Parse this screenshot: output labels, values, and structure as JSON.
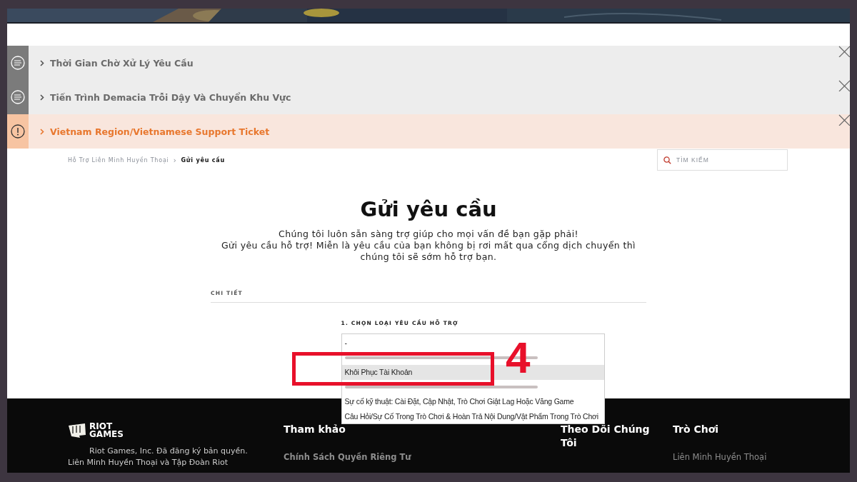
{
  "banner": {
    "kind": "picture"
  },
  "notices": [
    {
      "kind": "info",
      "title": "Thời Gian Chờ Xử Lý Yêu Cầu"
    },
    {
      "kind": "info",
      "title": "Tiến Trình Demacia Trỗi Dậy Và Chuyển Khu Vực"
    },
    {
      "kind": "warning",
      "title": "Vietnam Region/Vietnamese Support Ticket"
    }
  ],
  "breadcrumb": [
    {
      "label": "Hỗ Trợ Liên Minh Huyền Thoại",
      "selected": false
    },
    {
      "label": "Gửi yêu cầu",
      "selected": true
    }
  ],
  "breadcrumb_separator": "›",
  "search": {
    "placeholder": "TÌM KIẾM"
  },
  "title": "Gửi yêu cầu",
  "intro": [
    "Chúng tôi luôn sẵn sàng trợ giúp cho mọi vấn đề bạn gặp phải!",
    "Gửi yêu cầu hỗ trợ! Miễn là yêu cầu của bạn không bị rơi mất qua cổng dịch chuyển thì chúng tôi sẽ sớm hỗ trợ bạn."
  ],
  "section_label": "CHI TIẾT",
  "field_label": "1. CHỌN LOẠI YÊU CẦU HỖ TRỢ",
  "options": [
    {
      "kind": "text",
      "label": "-",
      "selected": false
    },
    {
      "kind": "obscured",
      "selected": false
    },
    {
      "kind": "text",
      "label": "Khôi Phục Tài Khoản",
      "selected": true
    },
    {
      "kind": "obscured",
      "selected": false
    },
    {
      "kind": "text",
      "label": "Sự cố kỹ thuật: Cài Đặt, Cập Nhật, Trò Chơi Giật Lag Hoặc Văng Game",
      "selected": false
    },
    {
      "kind": "text",
      "label": "Câu Hỏi/Sự Cố Trong Trò Chơi & Hoàn Trả Nội Dung/Vật Phẩm Trong Trò Chơi",
      "selected": false
    }
  ],
  "annotation": {
    "label": "4"
  },
  "footer": {
    "logo": [
      "RIOT",
      "GAMES"
    ],
    "copyright": "Riot Games, Inc. Đã đăng ký bản quyền. Liên Minh Huyền Thoại và Tập Đoàn Riot",
    "columns": [
      {
        "heading": "Tham khảo",
        "links": [
          "Chính Sách Quyền Riêng Tư"
        ]
      },
      {
        "heading": "Theo Dõi Chúng Tôi"
      },
      {
        "heading": "Trò Chơi",
        "links": [
          "Liên Minh Huyền Thoại"
        ]
      }
    ]
  }
}
